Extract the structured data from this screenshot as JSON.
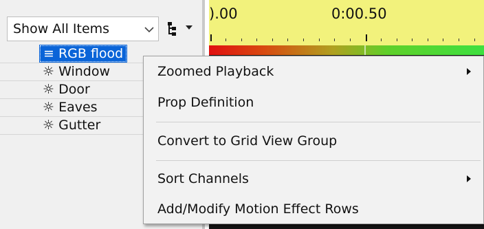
{
  "filter": {
    "value": "Show All Items",
    "chevron_icon": "chevron-down-icon"
  },
  "tree_button": {
    "icon": "tree-structure-icon"
  },
  "channels": [
    {
      "icon": "≡",
      "label": "RGB flood",
      "selected": true
    },
    {
      "icon": "☼",
      "label": "Window"
    },
    {
      "icon": "☼",
      "label": "Door"
    },
    {
      "icon": "☼",
      "label": "Eaves"
    },
    {
      "icon": "☼",
      "label": "Gutter"
    }
  ],
  "timeline": {
    "labels": [
      ").00",
      "0:00.50"
    ]
  },
  "context_menu": {
    "items": [
      {
        "label": "Zoomed Playback",
        "submenu": true
      },
      {
        "label": "Prop Definition",
        "submenu": false
      },
      {
        "label": "Convert to Grid View Group",
        "submenu": false
      },
      {
        "label": "Sort Channels",
        "submenu": true
      },
      {
        "label": "Add/Modify Motion Effect Rows",
        "submenu": false
      }
    ]
  },
  "colors": {
    "selection": "#0a64d8",
    "timeline_bg": "#f2f27c",
    "gradient_start": "#e01010",
    "gradient_end": "#3ee040"
  }
}
